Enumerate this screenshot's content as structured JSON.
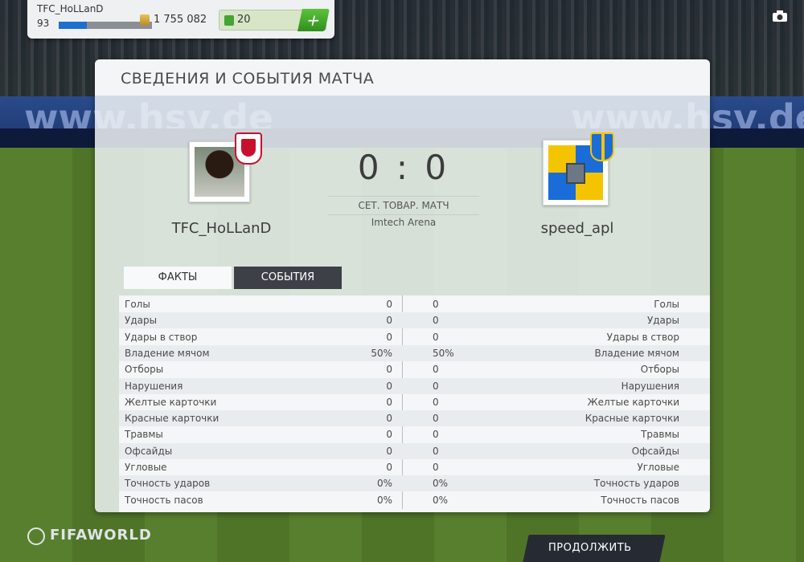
{
  "topbar": {
    "username": "TFC_HoLLanD",
    "level": "93",
    "xp_fraction": 0.3,
    "coins": "1 755 082",
    "points": "20",
    "add_label": "+"
  },
  "background": {
    "ad_text": "www.hsv.de"
  },
  "panel": {
    "title": "СВЕДЕНИЯ И СОБЫТИЯ МАТЧА",
    "home_team": "TFC_HoLLanD",
    "away_team": "speed_apl",
    "score": "0 : 0",
    "match_type": "СЕТ. ТОВАР. МАТЧ",
    "stadium": "Imtech Arena",
    "tabs": [
      "ФАКТЫ",
      "СОБЫТИЯ"
    ]
  },
  "stats": [
    {
      "label": "Голы",
      "home": "0",
      "away": "0"
    },
    {
      "label": "Удары",
      "home": "0",
      "away": "0"
    },
    {
      "label": "Удары в створ",
      "home": "0",
      "away": "0"
    },
    {
      "label": "Владение мячом",
      "home": "50%",
      "away": "50%"
    },
    {
      "label": "Отборы",
      "home": "0",
      "away": "0"
    },
    {
      "label": "Нарушения",
      "home": "0",
      "away": "0"
    },
    {
      "label": "Желтые карточки",
      "home": "0",
      "away": "0"
    },
    {
      "label": "Красные карточки",
      "home": "0",
      "away": "0"
    },
    {
      "label": "Травмы",
      "home": "0",
      "away": "0"
    },
    {
      "label": "Офсайды",
      "home": "0",
      "away": "0"
    },
    {
      "label": "Угловые",
      "home": "0",
      "away": "0"
    },
    {
      "label": "Точность ударов",
      "home": "0%",
      "away": "0%"
    },
    {
      "label": "Точность пасов",
      "home": "0%",
      "away": "0%"
    }
  ],
  "footer": {
    "logo": "FIFAWORLD",
    "continue_label": "ПРОДОЛЖИТЬ"
  },
  "colors": {
    "home_badge": "#c8102e",
    "away_primary": "#1a6cd9",
    "away_secondary": "#f5c400",
    "tab_active_dark": "#3d4047",
    "xp_bar": "#1e6fd0"
  },
  "icons": {
    "camera": "camera-icon",
    "coins": "coins-icon",
    "points": "fifa-points-icon",
    "add": "plus-icon"
  }
}
